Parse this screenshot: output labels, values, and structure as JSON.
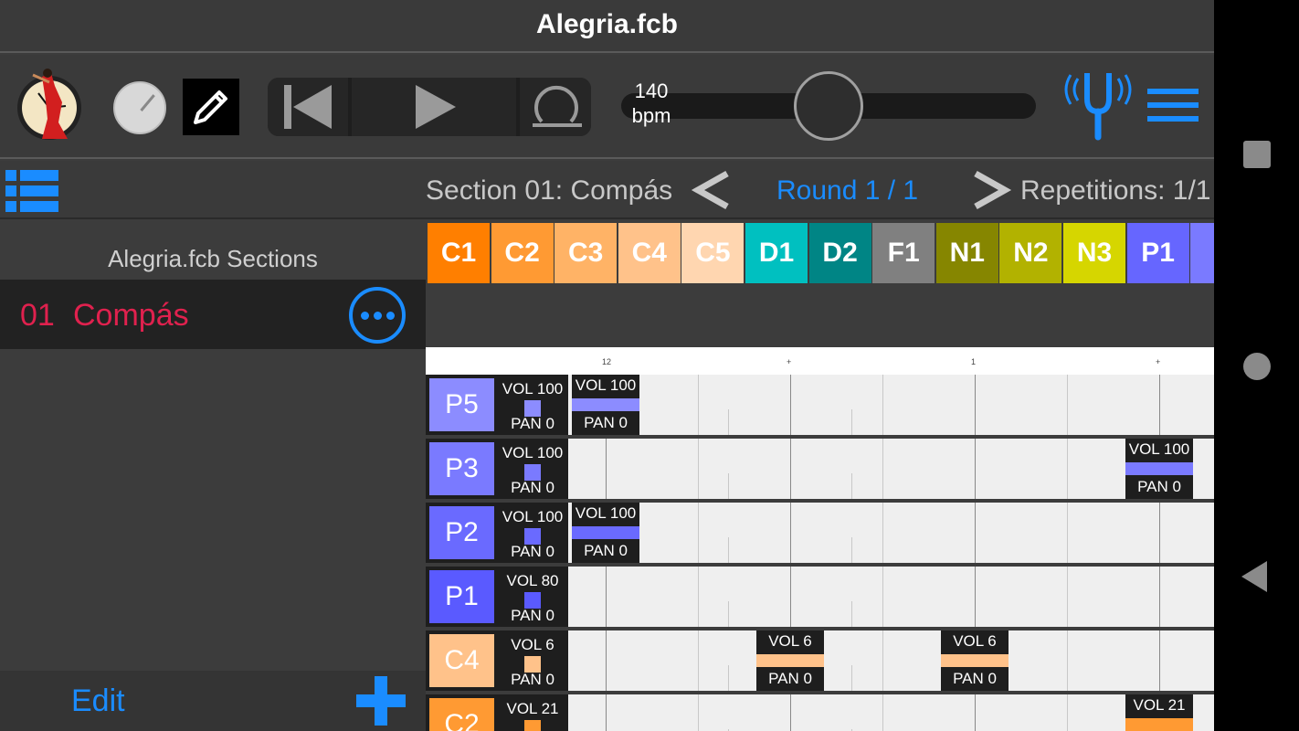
{
  "app": {
    "title": "Alegria.fcb"
  },
  "toolbar": {
    "bpm_value": "140",
    "bpm_unit": "bpm",
    "tempo": 140,
    "tempo_fraction": 0.45
  },
  "section_bar": {
    "section_label": "Section 01: Compás",
    "prev_label": "<",
    "round_label": "Round 1 / 1",
    "next_label": ">",
    "repetitions_label": "Repetitions: 1/1"
  },
  "sidebar": {
    "title": "Alegria.fcb Sections",
    "sections": [
      {
        "number": "01",
        "name": "Compás"
      }
    ],
    "edit_label": "Edit"
  },
  "palette": [
    {
      "label": "C1",
      "color": "#ff7f00"
    },
    {
      "label": "C2",
      "color": "#ff9a33"
    },
    {
      "label": "C3",
      "color": "#ffb366"
    },
    {
      "label": "C4",
      "color": "#ffc28a"
    },
    {
      "label": "C5",
      "color": "#ffd6b0"
    },
    {
      "label": "D1",
      "color": "#00c0c0"
    },
    {
      "label": "D2",
      "color": "#008585"
    },
    {
      "label": "F1",
      "color": "#808080"
    },
    {
      "label": "N1",
      "color": "#868600"
    },
    {
      "label": "N2",
      "color": "#b2b200"
    },
    {
      "label": "N3",
      "color": "#d6d600"
    },
    {
      "label": "P1",
      "color": "#6666ff"
    },
    {
      "label": "P",
      "color": "#7a7aff"
    }
  ],
  "ruler_ticks": [
    "12",
    "+",
    "1",
    "+"
  ],
  "tracks": [
    {
      "label": "P5",
      "color": "#8c8cff",
      "vol": "VOL 100",
      "pan": "PAN 0",
      "notes": [
        {
          "vol": "VOL 100",
          "pan": "PAN 0",
          "beat": 0
        }
      ]
    },
    {
      "label": "P3",
      "color": "#7a7aff",
      "vol": "VOL 100",
      "pan": "PAN 0",
      "notes": [
        {
          "vol": "VOL 100",
          "pan": "PAN 0",
          "beat": 3
        }
      ]
    },
    {
      "label": "P2",
      "color": "#6a6aff",
      "vol": "VOL 100",
      "pan": "PAN 0",
      "notes": [
        {
          "vol": "VOL 100",
          "pan": "PAN 0",
          "beat": 0
        }
      ]
    },
    {
      "label": "P1",
      "color": "#5a5aff",
      "vol": "VOL 80",
      "pan": "PAN 0",
      "notes": []
    },
    {
      "label": "C4",
      "color": "#ffc28a",
      "vol": "VOL 6",
      "pan": "PAN 0",
      "notes": [
        {
          "vol": "VOL 6",
          "pan": "PAN 0",
          "beat": 1
        },
        {
          "vol": "VOL 6",
          "pan": "PAN 0",
          "beat": 2
        }
      ]
    },
    {
      "label": "C2",
      "color": "#ff9a33",
      "vol": "VOL 21",
      "pan": "PAN 0",
      "notes": [
        {
          "vol": "VOL 21",
          "pan": "PAN 0",
          "beat": 3
        }
      ]
    }
  ],
  "colors": {
    "accent": "#1a8cff",
    "selected_section": "#e0214e"
  }
}
